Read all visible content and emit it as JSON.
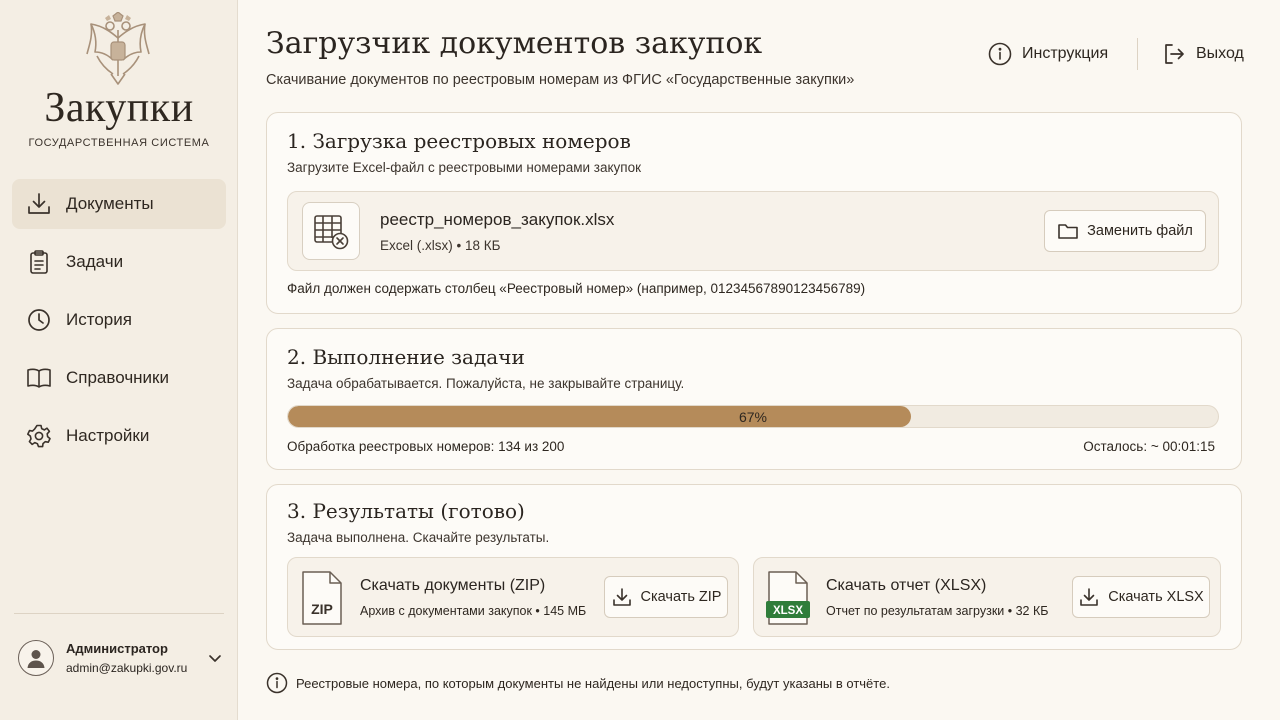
{
  "colors": {
    "accent": "#b58b5a",
    "background": "#fbf8f2",
    "sidebar": "#f4eee4",
    "excel_green": "#2f7d3a"
  },
  "sidebar": {
    "logo_title": "Закупки",
    "logo_subtitle": "ГОСУДАРСТВЕННАЯ СИСТЕМА",
    "items": [
      {
        "label": "Документы",
        "icon": "download-icon",
        "active": true
      },
      {
        "label": "Задачи",
        "icon": "clipboard-icon",
        "active": false
      },
      {
        "label": "История",
        "icon": "clock-icon",
        "active": false
      },
      {
        "label": "Справочники",
        "icon": "book-icon",
        "active": false
      },
      {
        "label": "Настройки",
        "icon": "gear-icon",
        "active": false
      }
    ],
    "user": {
      "name": "Администратор",
      "email": "admin@zakupki.gov.ru"
    }
  },
  "header": {
    "title": "Загрузчик документов закупок",
    "subtitle": "Скачивание документов по реестровым номерам из ФГИС «Государственные закупки»",
    "help_label": "Инструкция",
    "logout_label": "Выход"
  },
  "upload": {
    "title": "1. Загрузка реестровых номеров",
    "description": "Загрузите Excel-файл с реестровыми номерами закупок",
    "file_name": "реестр_номеров_закупок.xlsx",
    "file_meta": "Excel (.xlsx) • 18 КБ",
    "replace_label": "Заменить файл",
    "hint": "Файл должен содержать столбец «Реестровый номер» (например, 01234567890123456789)"
  },
  "task": {
    "title": "2. Выполнение задачи",
    "description": "Задача обрабатывается. Пожалуйста, не закрывайте страницу.",
    "progress_percent": 67,
    "progress_label": "67%",
    "processed_text": "Обработка реестровых номеров: 134 из 200",
    "remaining_text": "Осталось: ~ 00:01:15"
  },
  "results": {
    "title": "3. Результаты (готово)",
    "description": "Задача выполнена. Скачайте результаты.",
    "zip": {
      "icon_text": "ZIP",
      "title": "Скачать документы (ZIP)",
      "meta": "Архив с документами закупок • 145 МБ",
      "button_label": "Скачать ZIP"
    },
    "xlsx": {
      "icon_text": "XLSX",
      "title": "Скачать отчет (XLSX)",
      "meta": "Отчет по результатам загрузки • 32 КБ",
      "button_label": "Скачать XLSX"
    }
  },
  "footer_note": "Реестровые номера, по которым документы не найдены или недоступны, будут указаны в отчёте."
}
